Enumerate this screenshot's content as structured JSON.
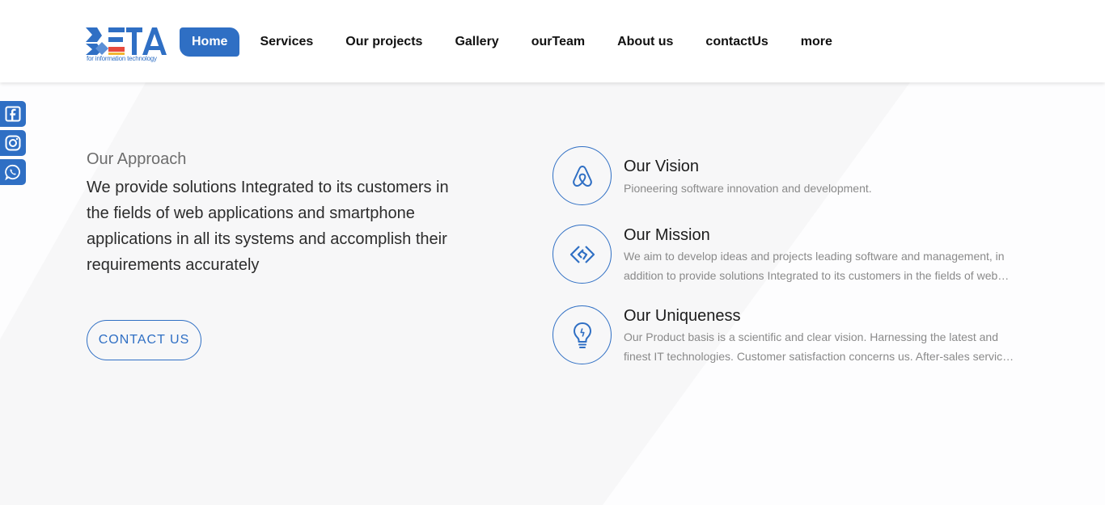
{
  "brand": {
    "logo_text": "META",
    "tagline": "for information technology",
    "accent_color": "#2f6fc4",
    "logo_colors": [
      "#2f6fc4",
      "#e84a3c",
      "#f2b632"
    ]
  },
  "nav": {
    "items": [
      {
        "label": "Home",
        "active": true
      },
      {
        "label": "Services"
      },
      {
        "label": "Our projects"
      },
      {
        "label": "Gallery"
      },
      {
        "label": "ourTeam"
      },
      {
        "label": "About us"
      },
      {
        "label": "contactUs"
      },
      {
        "label": "more"
      }
    ]
  },
  "social": [
    {
      "icon": "facebook-icon"
    },
    {
      "icon": "instagram-icon"
    },
    {
      "icon": "whatsapp-icon"
    }
  ],
  "approach": {
    "title": "Our Approach",
    "text": "We provide solutions Integrated to its customers in the fields of web applications and smartphone applications in all its systems and accomplish their requirements accurately",
    "button_label": "CONTACT US"
  },
  "features": [
    {
      "icon": "airbnb-icon",
      "title": "Our Vision",
      "description": "Pioneering software innovation and development."
    },
    {
      "icon": "code-diamond-icon",
      "title": "Our Mission",
      "description": "We aim to develop ideas and projects leading software and management, in addition to provide solutions Integrated to its customers in the fields of web applications and smartphone applications."
    },
    {
      "icon": "lightbulb-icon",
      "title": "Our Uniqueness",
      "description": "Our Product basis is a scientific and clear vision. Harnessing the latest and finest IT technologies. Customer satisfaction concerns us. After-sales service and continuous support."
    }
  ]
}
